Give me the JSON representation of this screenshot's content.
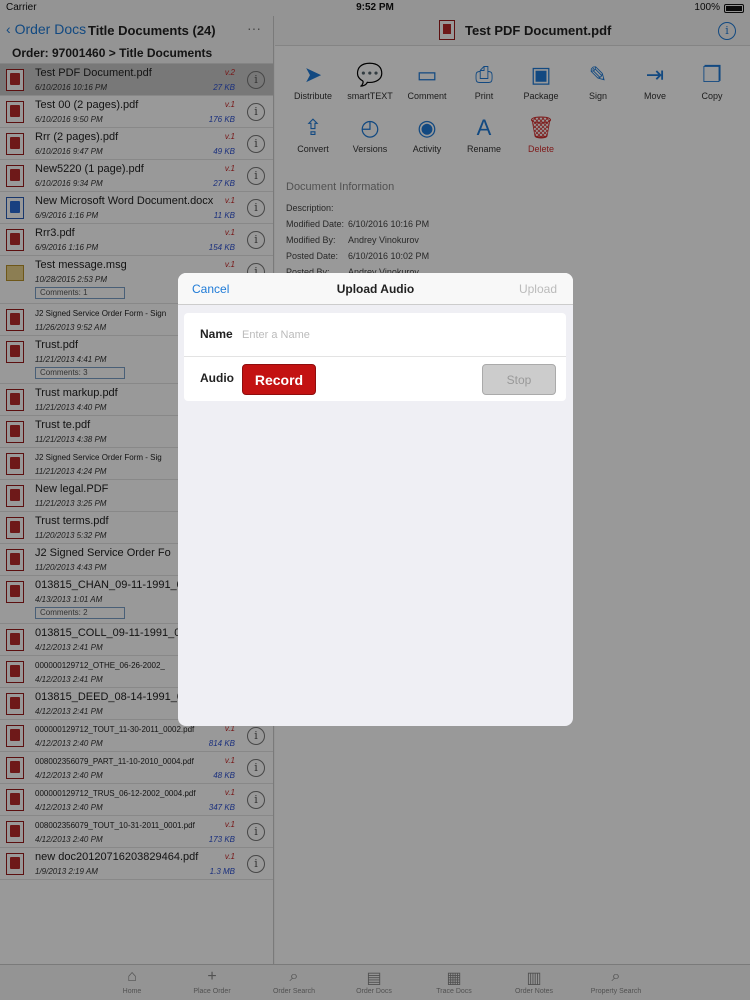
{
  "status": {
    "carrier": "Carrier",
    "time": "9:52 PM",
    "battery": "100%"
  },
  "left": {
    "back_label": "Order Docs",
    "title": "Title Documents (24)",
    "more": "···",
    "order_path": "Order: 97001460 > Title Documents",
    "docs": [
      {
        "name": "Test PDF Document.pdf",
        "date": "6/10/2016 10:16 PM",
        "version": "v.2",
        "size": "27 KB",
        "type": "pdf",
        "selected": true
      },
      {
        "name": "Test 00 (2 pages).pdf",
        "date": "6/10/2016 9:50 PM",
        "version": "v.1",
        "size": "176 KB",
        "type": "pdf"
      },
      {
        "name": "Rrr (2 pages).pdf",
        "date": "6/10/2016 9:47 PM",
        "version": "v.1",
        "size": "49 KB",
        "type": "pdf"
      },
      {
        "name": "New5220 (1 page).pdf",
        "date": "6/10/2016 9:34 PM",
        "version": "v.1",
        "size": "27 KB",
        "type": "pdf"
      },
      {
        "name": "New Microsoft Word Document.docx",
        "date": "6/9/2016 1:16 PM",
        "version": "v.1",
        "size": "11 KB",
        "type": "word"
      },
      {
        "name": "Rrr3.pdf",
        "date": "6/9/2016 1:16 PM",
        "version": "v.1",
        "size": "154 KB",
        "type": "pdf"
      },
      {
        "name": "Test message.msg",
        "date": "10/28/2015 2:53 PM",
        "version": "v.1",
        "size": "",
        "type": "mail",
        "comments": "Comments: 1"
      },
      {
        "name": "J2 Signed Service Order Form - Sign",
        "date": "11/26/2013 9:52 AM",
        "version": "",
        "size": "",
        "type": "pdf",
        "small": true
      },
      {
        "name": "Trust.pdf",
        "date": "11/21/2013 4:41 PM",
        "version": "",
        "size": "",
        "type": "pdf",
        "comments": "Comments: 3"
      },
      {
        "name": "Trust markup.pdf",
        "date": "11/21/2013 4:40 PM",
        "version": "",
        "size": "",
        "type": "pdf"
      },
      {
        "name": "Trust te.pdf",
        "date": "11/21/2013 4:38 PM",
        "version": "",
        "size": "",
        "type": "pdf"
      },
      {
        "name": "J2 Signed Service Order Form - Sig",
        "date": "11/21/2013 4:24 PM",
        "version": "",
        "size": "",
        "type": "pdf",
        "small": true
      },
      {
        "name": "New legal.PDF",
        "date": "11/21/2013 3:25 PM",
        "version": "",
        "size": "",
        "type": "pdf"
      },
      {
        "name": "Trust terms.pdf",
        "date": "11/20/2013 5:32 PM",
        "version": "",
        "size": "",
        "type": "pdf"
      },
      {
        "name": "J2 Signed Service Order Fo",
        "date": "11/20/2013 4:43 PM",
        "version": "",
        "size": "",
        "type": "pdf"
      },
      {
        "name": "013815_CHAN_09-11-1991_00",
        "date": "4/13/2013 1:01 AM",
        "version": "",
        "size": "",
        "type": "pdf",
        "comments": "Comments: 2"
      },
      {
        "name": "013815_COLL_09-11-1991_00",
        "date": "4/12/2013 2:41 PM",
        "version": "",
        "size": "",
        "type": "pdf"
      },
      {
        "name": "000000129712_OTHE_06-26-2002_",
        "date": "4/12/2013 2:41 PM",
        "version": "",
        "size": "",
        "type": "pdf",
        "small": true
      },
      {
        "name": "013815_DEED_08-14-1991_00",
        "date": "4/12/2013 2:41 PM",
        "version": "",
        "size": "",
        "type": "pdf"
      },
      {
        "name": "000000129712_TOUT_11-30-2011_0002.pdf",
        "date": "4/12/2013 2:40 PM",
        "version": "v.1",
        "size": "814 KB",
        "type": "pdf",
        "small": true
      },
      {
        "name": "008002356079_PART_11-10-2010_0004.pdf",
        "date": "4/12/2013 2:40 PM",
        "version": "v.1",
        "size": "48 KB",
        "type": "pdf",
        "small": true
      },
      {
        "name": "000000129712_TRUS_06-12-2002_0004.pdf",
        "date": "4/12/2013 2:40 PM",
        "version": "v.1",
        "size": "347 KB",
        "type": "pdf",
        "small": true
      },
      {
        "name": "008002356079_TOUT_10-31-2011_0001.pdf",
        "date": "4/12/2013 2:40 PM",
        "version": "v.1",
        "size": "173 KB",
        "type": "pdf",
        "small": true
      },
      {
        "name": "new doc20120716203829464.pdf",
        "date": "1/9/2013 2:19 AM",
        "version": "v.1",
        "size": "1.3 MB",
        "type": "pdf"
      }
    ]
  },
  "right": {
    "title": "Test PDF Document.pdf",
    "actions": [
      {
        "label": "Distribute",
        "icon": "paper-plane-icon",
        "glyph": "➤"
      },
      {
        "label": "smartTEXT",
        "icon": "chat-bubble-icon",
        "glyph": "💬"
      },
      {
        "label": "Comment",
        "icon": "comment-icon",
        "glyph": "▭"
      },
      {
        "label": "Print",
        "icon": "printer-icon",
        "glyph": "⎙"
      },
      {
        "label": "Package",
        "icon": "briefcase-icon",
        "glyph": "▣"
      },
      {
        "label": "Sign",
        "icon": "pen-icon",
        "glyph": "✎"
      },
      {
        "label": "Move",
        "icon": "move-icon",
        "glyph": "⇥"
      },
      {
        "label": "Copy",
        "icon": "copy-icon",
        "glyph": "❐"
      },
      {
        "label": "Convert",
        "icon": "share-icon",
        "glyph": "⇪"
      },
      {
        "label": "Versions",
        "icon": "clock-icon",
        "glyph": "◴"
      },
      {
        "label": "Activity",
        "icon": "eye-icon",
        "glyph": "◉"
      },
      {
        "label": "Rename",
        "icon": "rename-icon",
        "glyph": "A"
      },
      {
        "label": "Delete",
        "icon": "trash-icon",
        "glyph": "🗑"
      }
    ],
    "doc_info_heading": "Document Information",
    "doc_info": [
      {
        "key": "Description:",
        "value": ""
      },
      {
        "key": "Modified Date:",
        "value": "6/10/2016 10:16 PM"
      },
      {
        "key": "Modified By:",
        "value": "Andrey Vinokurov"
      },
      {
        "key": "Posted Date:",
        "value": "6/10/2016 10:02 PM"
      },
      {
        "key": "Posted By:",
        "value": "Andrey Vinokurov"
      }
    ]
  },
  "tabs": [
    {
      "label": "Home",
      "icon": "home-icon",
      "glyph": "⌂"
    },
    {
      "label": "Place Order",
      "icon": "plus-icon",
      "glyph": "+"
    },
    {
      "label": "Order Search",
      "icon": "search-icon",
      "glyph": "⌕"
    },
    {
      "label": "Order Docs",
      "icon": "docs-icon",
      "glyph": "▤"
    },
    {
      "label": "Trace Docs",
      "icon": "grid-icon",
      "glyph": "▦"
    },
    {
      "label": "Order Notes",
      "icon": "notes-icon",
      "glyph": "▥"
    },
    {
      "label": "Property Search",
      "icon": "property-search-icon",
      "glyph": "⌕"
    }
  ],
  "modal": {
    "cancel": "Cancel",
    "title": "Upload Audio",
    "upload": "Upload",
    "name_label": "Name",
    "name_placeholder": "Enter a Name",
    "name_value": "",
    "audio_label": "Audio",
    "record": "Record",
    "stop": "Stop"
  }
}
